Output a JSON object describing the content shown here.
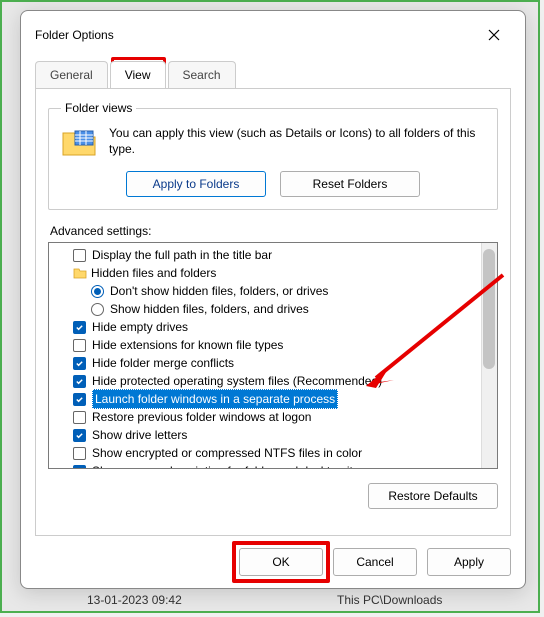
{
  "dialog": {
    "title": "Folder Options"
  },
  "tabs": {
    "general": "General",
    "view": "View",
    "search": "Search"
  },
  "folderViews": {
    "legend": "Folder views",
    "description": "You can apply this view (such as Details or Icons) to all folders of this type.",
    "applyBtn": "Apply to Folders",
    "resetBtn": "Reset Folders"
  },
  "advanced": {
    "label": "Advanced settings:",
    "items": {
      "fullPath": "Display the full path in the title bar",
      "hiddenGroup": "Hidden files and folders",
      "dontShowHidden": "Don't show hidden files, folders, or drives",
      "showHidden": "Show hidden files, folders, and drives",
      "hideEmpty": "Hide empty drives",
      "hideExt": "Hide extensions for known file types",
      "hideMerge": "Hide folder merge conflicts",
      "hideOS": "Hide protected operating system files (Recommended)",
      "launchSep": "Launch folder windows in a separate process",
      "restorePrev": "Restore previous folder windows at logon",
      "showDrive": "Show drive letters",
      "showEnc": "Show encrypted or compressed NTFS files in color",
      "showPopup": "Show pop-up description for folder and desktop items"
    }
  },
  "restoreDefaults": "Restore Defaults",
  "buttons": {
    "ok": "OK",
    "cancel": "Cancel",
    "apply": "Apply"
  },
  "status": {
    "date": "13-01-2023 09:42",
    "path": "This PC\\Downloads"
  }
}
